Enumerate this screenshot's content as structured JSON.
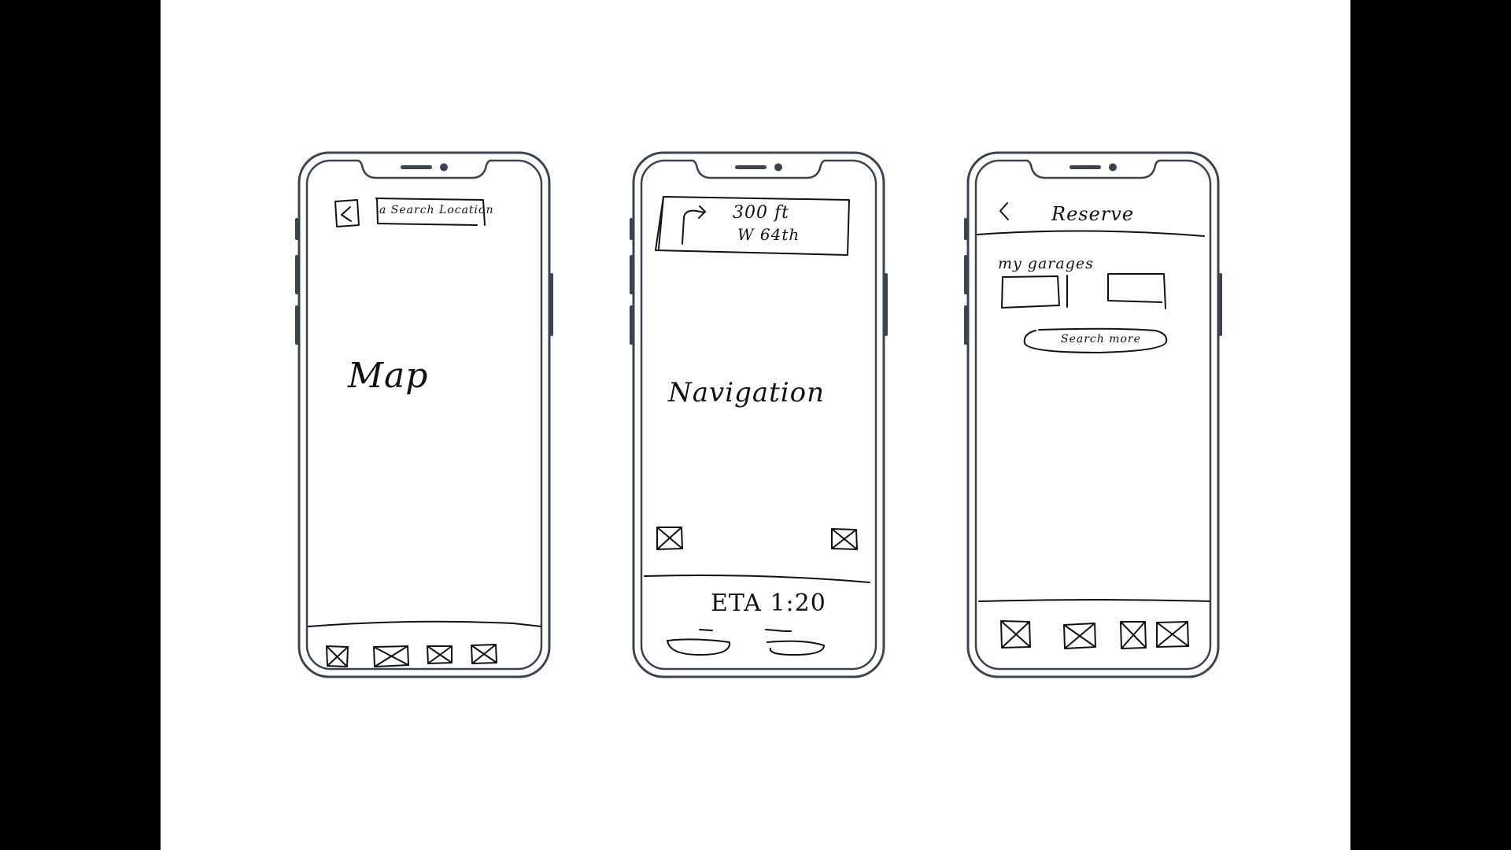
{
  "colors": {
    "backdrop": "#000000",
    "canvas": "#ffffff",
    "device_outline": "#3b4252",
    "ink": "#111111"
  },
  "map_screen": {
    "back_icon": "chevron-left-icon",
    "search_label": "a Search Location",
    "center_label": "Map",
    "tab_icons": [
      "placeholder-icon",
      "placeholder-icon",
      "placeholder-icon",
      "placeholder-icon"
    ]
  },
  "navigation_screen": {
    "turn_icon": "turn-right-arrow-icon",
    "distance": "300 ft",
    "street": "W 64th",
    "center_label": "Navigation",
    "eta": "ETA 1:20"
  },
  "reserve_screen": {
    "back_icon": "chevron-left-icon",
    "title": "Reserve",
    "section_label": "my garages",
    "search_more_label": "Search more",
    "tab_icons": [
      "placeholder-icon",
      "placeholder-icon",
      "placeholder-icon",
      "placeholder-icon"
    ]
  }
}
